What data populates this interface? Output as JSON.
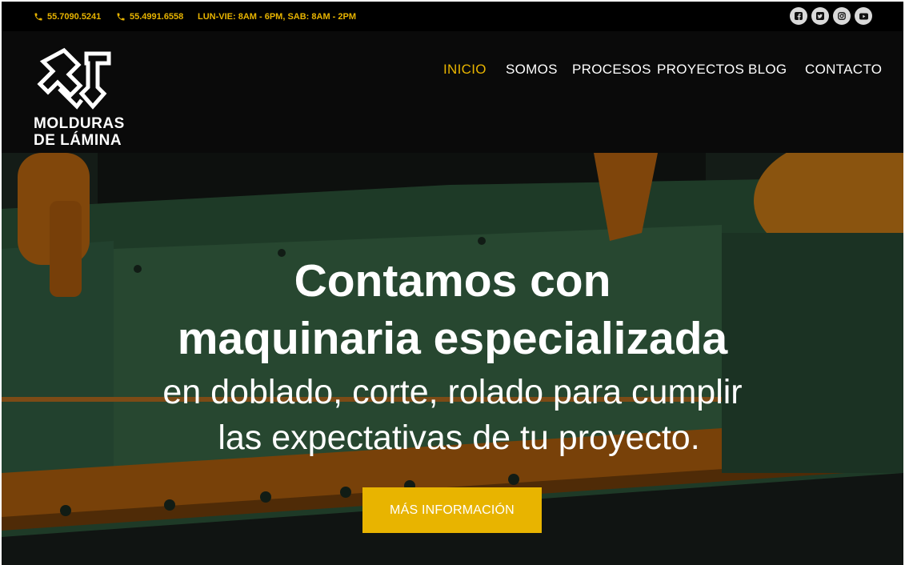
{
  "topbar": {
    "phone1": "55.7090.5241",
    "phone2": "55.4991.6558",
    "hours": "LUN-VIE: 8AM - 6PM, SAB: 8AM - 2PM",
    "social": [
      "facebook-icon",
      "twitter-icon",
      "instagram-icon",
      "youtube-icon"
    ]
  },
  "logo": {
    "line1": "MOLDURAS",
    "line2": "DE LÁMINA"
  },
  "nav": {
    "items": [
      {
        "label": "INICIO",
        "active": true
      },
      {
        "label": "SOMOS"
      },
      {
        "label": "PROCESOS"
      },
      {
        "label": "PROYECTOS"
      },
      {
        "label": "BLOG"
      },
      {
        "label": "CONTACTO"
      }
    ]
  },
  "hero": {
    "line1": "Contamos con",
    "line2": "maquinaria especializada",
    "line3": "en doblado, corte, rolado para cumplir",
    "line4": "las expectativas de tu proyecto.",
    "cta": "MÁS INFORMACIÓN"
  },
  "colors": {
    "accent": "#e8b400",
    "topbar": "#000000",
    "header": "#0a0a0a"
  }
}
